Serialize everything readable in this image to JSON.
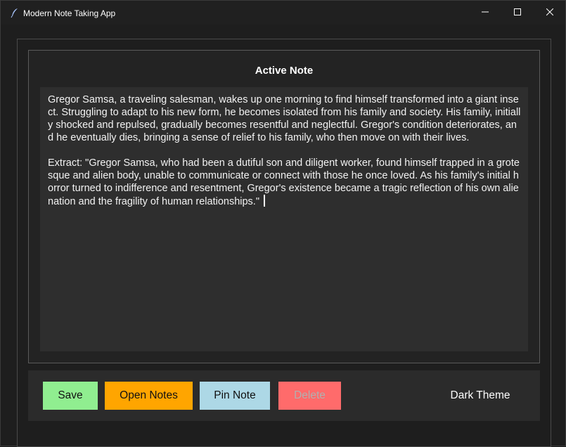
{
  "window": {
    "title": "Modern Note Taking App",
    "icon": "feather-icon",
    "controls": [
      "minimize-icon",
      "maximize-icon",
      "close-icon"
    ]
  },
  "note": {
    "header": "Active Note",
    "text": "Gregor Samsa, a traveling salesman, wakes up one morning to find himself transformed into a giant insect. Struggling to adapt to his new form, he becomes isolated from his family and society. His family, initially shocked and repulsed, gradually becomes resentful and neglectful. Gregor's condition deteriorates, and he eventually dies, bringing a sense of relief to his family, who then move on with their lives.\n\nExtract: \"Gregor Samsa, who had been a dutiful son and diligent worker, found himself trapped in a grotesque and alien body, unable to communicate or connect with those he once loved. As his family's initial horror turned to indifference and resentment, Gregor's existence became a tragic reflection of his own alienation and the fragility of human relationships.\" "
  },
  "toolbar": {
    "save_label": "Save",
    "open_label": "Open Notes",
    "pin_label": "Pin Note",
    "delete_label": "Delete",
    "theme_label": "Dark Theme"
  },
  "colors": {
    "save": "#90ee90",
    "open": "#ffa500",
    "pin": "#add8e6",
    "delete": "#ff6b6b",
    "background": "#1e1e1e",
    "text_area": "#2e2e2e"
  }
}
